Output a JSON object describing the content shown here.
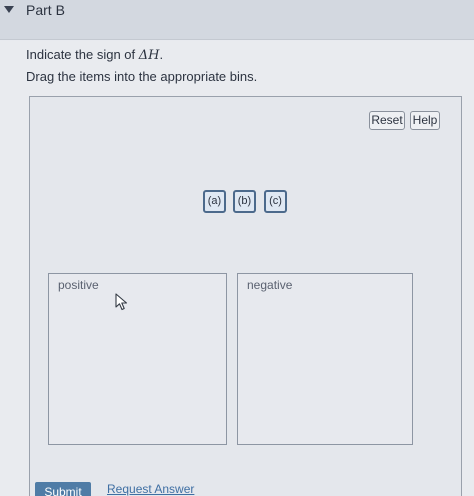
{
  "header": {
    "title": "Part B",
    "toggle_icon": "triangle-down-icon"
  },
  "question": {
    "prefix": "Indicate the sign of ",
    "math": "ΔH",
    "suffix": ".",
    "instruction": "Drag the items into the appropriate bins."
  },
  "toolbar": {
    "reset_label": "Reset",
    "help_label": "Help"
  },
  "items": [
    {
      "label": "(a)"
    },
    {
      "label": "(b)"
    },
    {
      "label": "(c)"
    }
  ],
  "bins": [
    {
      "label": "positive"
    },
    {
      "label": "negative"
    }
  ],
  "actions": {
    "submit_label": "Submit",
    "request_answer_label": "Request Answer"
  },
  "colors": {
    "submit_bg": "#4f7ca6",
    "item_border": "#4c6a8c",
    "link": "#3f6fa3"
  }
}
